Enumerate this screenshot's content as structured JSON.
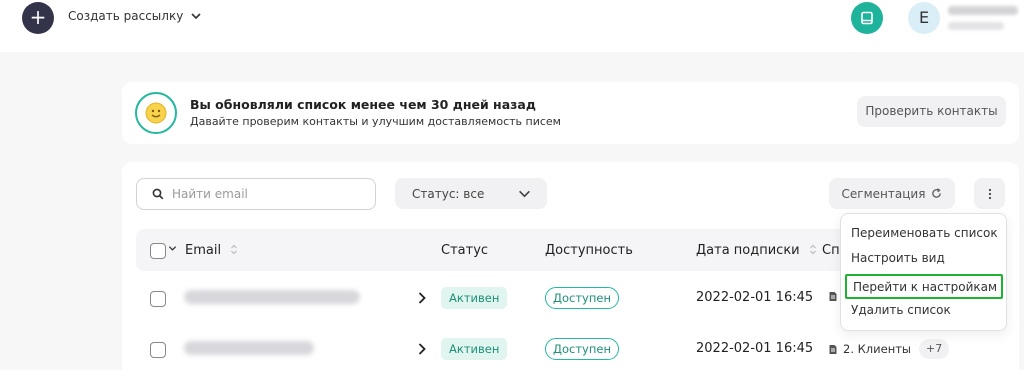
{
  "topbar": {
    "add_icon": "plus-icon",
    "create_mailing_label": "Создать рассылку",
    "avatar_letter": "E"
  },
  "notice": {
    "title": "Вы обновляли список менее чем 30 дней назад",
    "subtitle": "Давайте проверим контакты и улучшим доставляемость писем",
    "check_button": "Проверить контакты"
  },
  "toolbar": {
    "search_placeholder": "Найти email",
    "status_filter": "Статус: все",
    "segmentation_label": "Сегментация"
  },
  "table": {
    "columns": [
      "Email",
      "Статус",
      "Доступность",
      "Дата подписки",
      "Сп"
    ],
    "rows": [
      {
        "status": "Активен",
        "availability": "Доступен",
        "date": "2022-02-01 16:45",
        "list": "",
        "extra": ""
      },
      {
        "status": "Активен",
        "availability": "Доступен",
        "date": "2022-02-01 16:45",
        "list": "2. Клиенты",
        "extra": "+7"
      }
    ]
  },
  "menu": {
    "items": [
      "Переименовать список",
      "Настроить вид",
      "Перейти к настройкам",
      "Удалить список"
    ]
  },
  "colors": {
    "accent": "#25b79f",
    "highlight": "#1fb334",
    "dark_button": "#33334a"
  }
}
